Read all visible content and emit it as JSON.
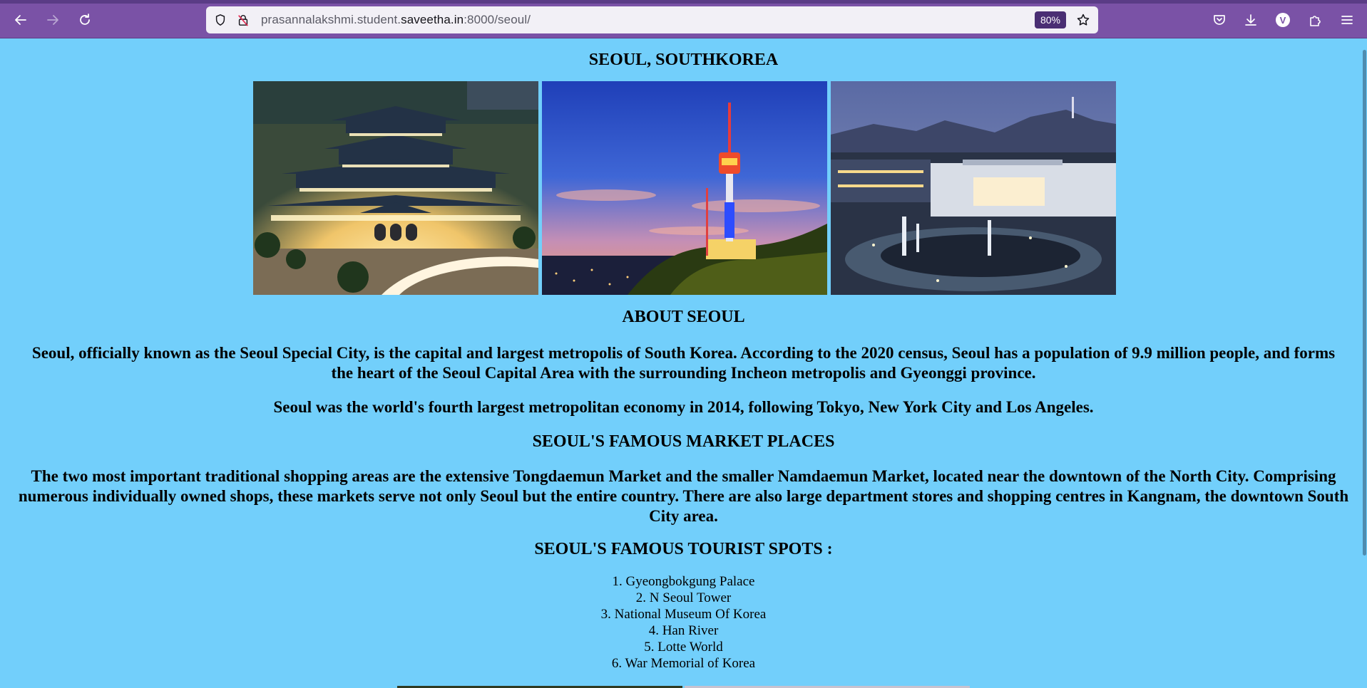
{
  "browser": {
    "url_prefix": "prasannalakshmi.student.",
    "url_domain": "saveetha.in",
    "url_suffix": ":8000/seoul/",
    "zoom": "80%",
    "profile_initial": "V"
  },
  "page": {
    "title": "SEOUL, SOUTHKOREA",
    "images": [
      {
        "name": "Gyeongbokgung Palace at night"
      },
      {
        "name": "N Seoul Tower at dusk"
      },
      {
        "name": "National Museum Of Korea"
      }
    ],
    "about_heading": "ABOUT SEOUL",
    "about_para1": "Seoul, officially known as the Seoul Special City, is the capital and largest metropolis of South Korea. According to the 2020 census, Seoul has a population of 9.9 million people, and forms the heart of the Seoul Capital Area with the surrounding Incheon metropolis and Gyeonggi province.",
    "about_para2": "Seoul was the world's fourth largest metropolitan economy in 2014, following Tokyo, New York City and Los Angeles.",
    "market_heading": "SEOUL'S FAMOUS MARKET PLACES",
    "market_para": "The two most important traditional shopping areas are the extensive Tongdaemun Market and the smaller Namdaemun Market, located near the downtown of the North City. Comprising numerous individually owned shops, these markets serve not only Seoul but the entire country. There are also large department stores and shopping centres in Kangnam, the downtown South City area.",
    "spots_heading": "SEOUL'S FAMOUS TOURIST SPOTS :",
    "spots": [
      "1. Gyeongbokgung Palace",
      "2. N Seoul Tower",
      "3. National Museum Of Korea",
      "4. Han River",
      "5. Lotte World",
      "6. War Memorial of Korea"
    ]
  },
  "colors": {
    "page_bg": "#72cffb",
    "toolbar_bg": "#7a52a6",
    "urlbar_bg": "#f2f0f6"
  },
  "icons": [
    "back-icon",
    "forward-icon",
    "reload-icon",
    "shield-icon",
    "insecure-lock-icon",
    "bookmark-star-icon",
    "pocket-icon",
    "download-icon",
    "extensions-icon",
    "menu-icon"
  ]
}
